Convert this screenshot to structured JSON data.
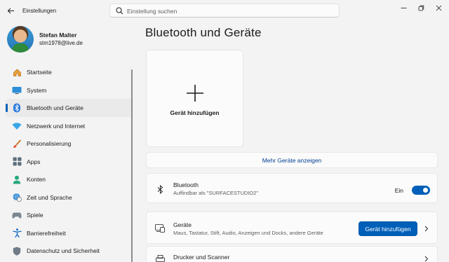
{
  "window": {
    "title": "Einstellungen"
  },
  "search": {
    "placeholder": "Einstellung suchen"
  },
  "profile": {
    "name": "Stefan Malter",
    "email": "stm1978@live.de"
  },
  "sidebar": {
    "items": [
      {
        "label": "Startseite",
        "icon": "home-icon"
      },
      {
        "label": "System",
        "icon": "monitor-icon"
      },
      {
        "label": "Bluetooth und Geräte",
        "icon": "bluetooth-icon",
        "active": true
      },
      {
        "label": "Netzwerk und Internet",
        "icon": "wifi-icon"
      },
      {
        "label": "Personalisierung",
        "icon": "brush-icon"
      },
      {
        "label": "Apps",
        "icon": "apps-icon"
      },
      {
        "label": "Konten",
        "icon": "account-icon"
      },
      {
        "label": "Zeit und Sprache",
        "icon": "globe-clock-icon"
      },
      {
        "label": "Spiele",
        "icon": "gamepad-icon"
      },
      {
        "label": "Barrierefreiheit",
        "icon": "accessibility-icon"
      },
      {
        "label": "Datenschutz und Sicherheit",
        "icon": "shield-icon"
      }
    ]
  },
  "main": {
    "title": "Bluetooth und Geräte",
    "add_tile_label": "Gerät hinzufügen",
    "more_devices_link": "Mehr Geräte anzeigen",
    "bluetooth": {
      "title": "Bluetooth",
      "subtitle": "Auffindbar als \"SURFACESTUDIO2\"",
      "toggle_state": "Ein",
      "enabled": true
    },
    "devices": {
      "title": "Geräte",
      "subtitle": "Maus, Tastatur, Stift, Audio, Anzeigen und Docks, andere Geräte",
      "button_label": "Gerät hinzufügen"
    },
    "printers": {
      "title": "Drucker und Scanner"
    }
  },
  "colors": {
    "accent": "#005fb8",
    "background": "#f3f3f3",
    "card": "#fbfbfb"
  }
}
